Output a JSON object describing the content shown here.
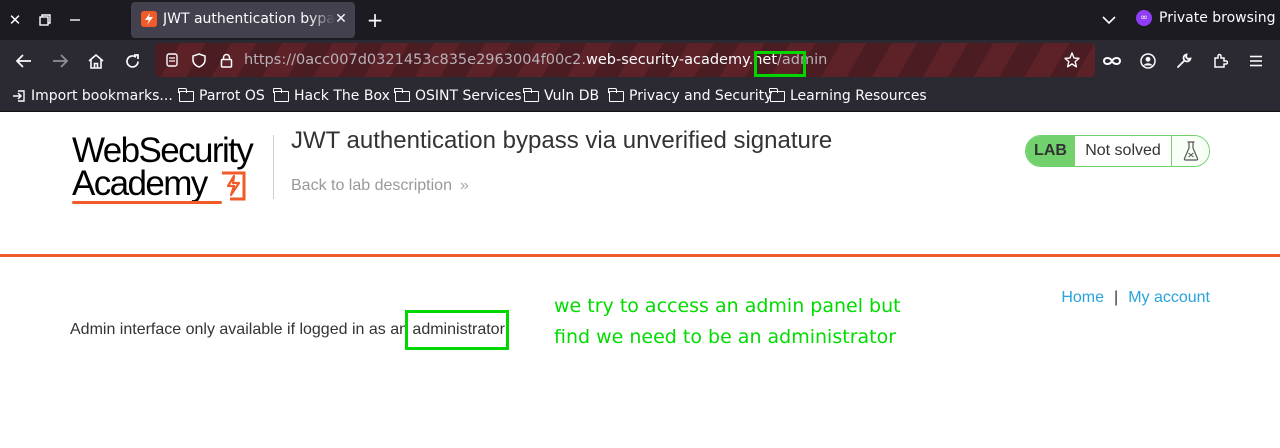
{
  "browser": {
    "tab": {
      "title": "JWT authentication bypass via unverified signature"
    },
    "private_label": "Private browsing",
    "url": {
      "scheme": "https://",
      "subdomain": "0acc007d0321453c835e2963004f00c2.",
      "domain": "web-security-academy.net",
      "path": "/admin"
    },
    "bookmarks": [
      "Import bookmarks...",
      "Parrot OS",
      "Hack The Box",
      "OSINT Services",
      "Vuln DB",
      "Privacy and Security",
      "Learning Resources"
    ]
  },
  "page": {
    "logo": {
      "line1": "WebSecurity",
      "line2": "Academy"
    },
    "title": "JWT authentication bypass via unverified signature",
    "back_link": "Back to lab description",
    "status": {
      "badge": "LAB",
      "text": "Not solved"
    },
    "nav": {
      "home": "Home",
      "separator": "|",
      "account": "My account"
    },
    "message": "Admin interface only available if logged in as an administrator"
  },
  "annotation": {
    "line1": "we try to access an admin panel but",
    "line2": "find we need to be an administrator",
    "color": "#00dc00"
  },
  "colors": {
    "accent_orange": "#f15a29",
    "status_green": "#70d16d",
    "link_blue": "#29a3dc"
  }
}
